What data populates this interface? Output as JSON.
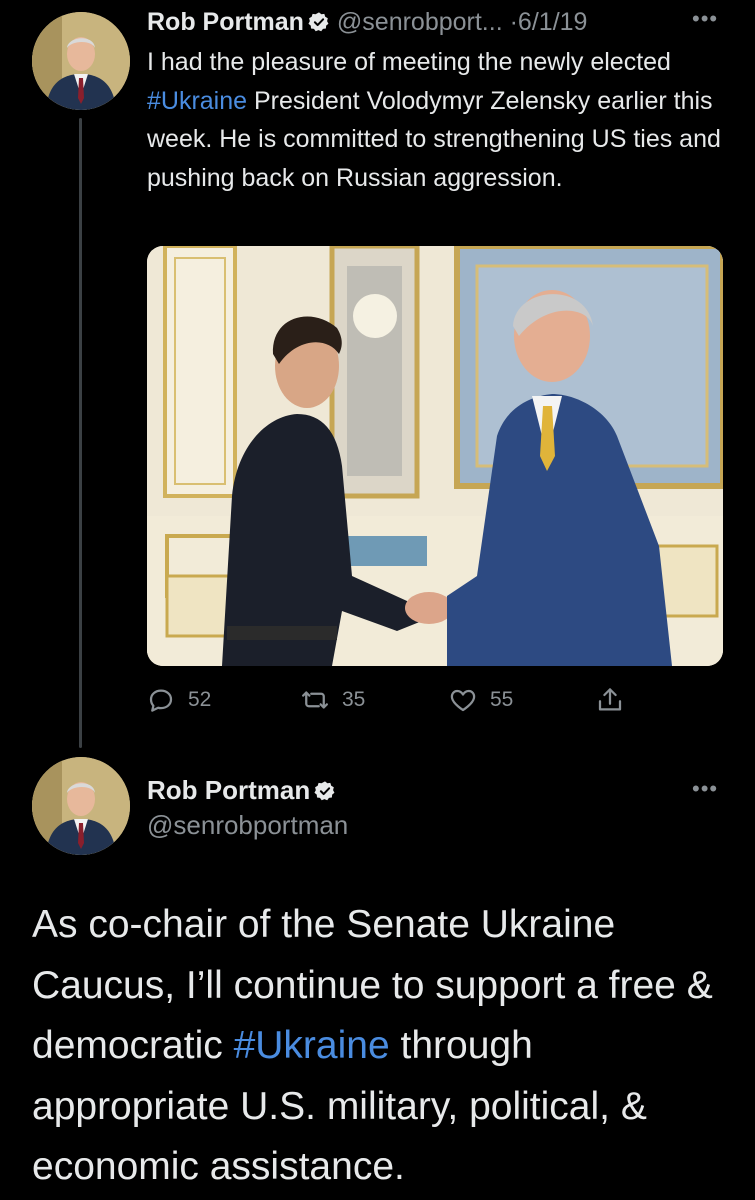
{
  "colors": {
    "background": "#000000",
    "text": "#e7e9ea",
    "muted": "#8b9196",
    "link": "#4a8ce0"
  },
  "tweet1": {
    "author_name": "Rob Portman",
    "author_handle": "@senrobport...",
    "date": "·6/1/19",
    "more_icon": "more-horizontal-icon",
    "text": {
      "part1": "I had the pleasure of meeting the newly elected ",
      "hashtag": "#Ukraine",
      "part2": " President Volodymyr Zelensky earlier this week. He is committed to strengthening US ties and pushing back on Russian aggression."
    },
    "actions": {
      "reply_count": "52",
      "retweet_count": "35",
      "like_count": "55"
    }
  },
  "tweet2": {
    "author_name": "Rob Portman",
    "author_handle": "@senrobportman",
    "more_icon": "more-horizontal-icon",
    "text": {
      "part1": "As co-chair of the Senate Ukraine Caucus, I’ll continue to support a free & democratic ",
      "hashtag": "#Ukraine",
      "part2": " through appropriate U.S. military, political, & economic assistance."
    }
  }
}
